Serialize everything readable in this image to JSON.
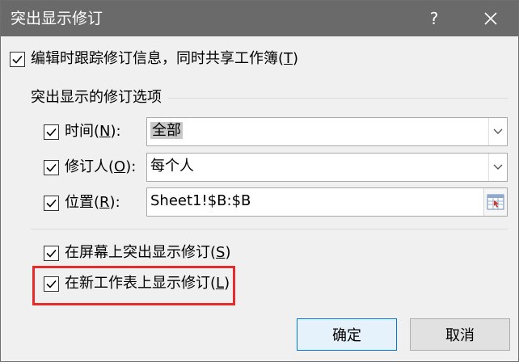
{
  "dialog": {
    "title": "突出显示修订",
    "help_label": "?"
  },
  "track_changes": {
    "label": "编辑时跟踪修订信息，同时共享工作簿(",
    "accel": "T",
    "suffix": ")",
    "checked": true
  },
  "group": {
    "title": "突出显示的修订选项"
  },
  "when": {
    "label": "时间(",
    "accel": "N",
    "suffix": "):",
    "value": "全部",
    "checked": true
  },
  "who": {
    "label": "修订人(",
    "accel": "O",
    "suffix": "):",
    "value": "每个人",
    "checked": true
  },
  "where": {
    "label": "位置(",
    "accel": "R",
    "suffix": "):",
    "value": "Sheet1!$B:$B",
    "checked": true
  },
  "highlight_on_screen": {
    "label": "在屏幕上突出显示修订(",
    "accel": "S",
    "suffix": ")",
    "checked": true
  },
  "list_on_new_sheet": {
    "label": "在新工作表上显示修订(",
    "accel": "L",
    "suffix": ")",
    "checked": true
  },
  "buttons": {
    "ok": "确定",
    "cancel": "取消"
  },
  "colors": {
    "titlebar": "#6a6a6a",
    "highlight": "#e52b2b",
    "ok_border": "#0078d7"
  }
}
